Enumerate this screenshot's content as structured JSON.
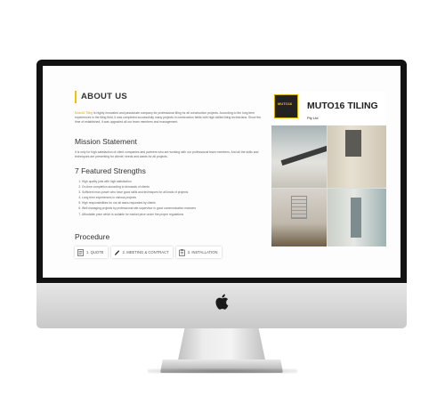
{
  "about": {
    "title": "ABOUT US",
    "intro_highlight": "Muto16 Tiling",
    "intro_text": " is highly innovated and passionate company for professional tiling for all construction projects. According to the long term experiences in the tiling field, it was completed successfully many projects in construction fields with high skilled tiling technicians. Since the time of established, it was upgraded all our team members and management."
  },
  "mission": {
    "heading": "Mission Statement",
    "text": "It is only for high satisfaction of client companies and partners who are working with our professional team members. And all the skills and techniques are presenting for clients' needs and wants for all projects."
  },
  "strengths": {
    "heading": "7 Featured Strengths",
    "items": [
      "High quality jobs with high satisfaction",
      "On-time completion according to demands of clients",
      "Sufficient man-power who have good skills and techniques for all kinds of projects",
      "Long term experiences in various projects",
      "High responsibilities for our all tasks requested by clients",
      "Well managing projects by professional site supervisor in good communication manners",
      "Affordable price which is suitable for market price under the proper regulations"
    ]
  },
  "procedure": {
    "heading": "Procedure",
    "steps": [
      {
        "label": "1. QUOTE",
        "icon": "document-icon"
      },
      {
        "label": "2. MEETING & CONTRACT",
        "icon": "pen-icon"
      },
      {
        "label": "3. INSTALLATION",
        "icon": "clipboard-icon"
      }
    ]
  },
  "logo": {
    "name": "MUTO16 TILING",
    "suffix": "Pty Ltd",
    "mark_text": "MUTO16"
  }
}
